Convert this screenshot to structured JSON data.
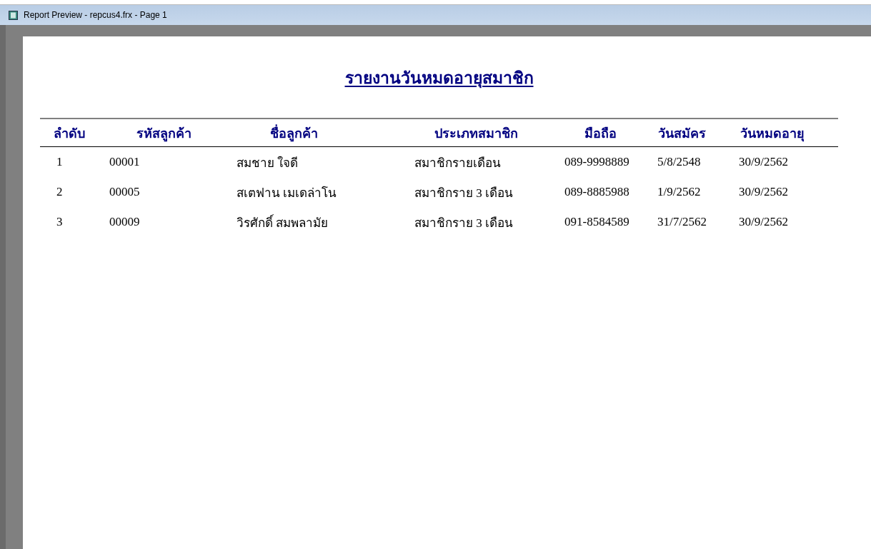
{
  "window": {
    "title": "Report Preview - repcus4.frx - Page 1"
  },
  "report": {
    "title": "รายงานวันหมดอายุสมาชิก",
    "columns": [
      "ลำดับ",
      "รหัสลูกค้า",
      "ชื่อลูกค้า",
      "ประเภทสมาชิก",
      "มือถือ",
      "วันสมัคร",
      "วันหมดอายุ"
    ],
    "rows": [
      [
        "1",
        "00001",
        "สมชาย ใจดี",
        "สมาชิกรายเดือน",
        "089-9998889",
        "5/8/2548",
        "30/9/2562"
      ],
      [
        "2",
        "00005",
        "สเตฟาน เมเดล่าโน",
        "สมาชิกราย 3 เดือน",
        "089-8885988",
        "1/9/2562",
        "30/9/2562"
      ],
      [
        "3",
        "00009",
        "วิรศักดิ์ สมพลามัย",
        "สมาชิกราย 3 เดือน",
        "091-8584589",
        "31/7/2562",
        "30/9/2562"
      ]
    ]
  }
}
